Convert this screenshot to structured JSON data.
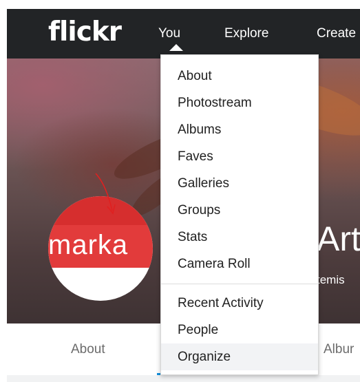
{
  "navbar": {
    "logo": "flickr",
    "links": [
      "You",
      "Explore",
      "Create"
    ]
  },
  "profile": {
    "avatar_text": "marka",
    "name": "Art",
    "handle": "temis"
  },
  "dropdown": {
    "items": [
      "About",
      "Photostream",
      "Albums",
      "Faves",
      "Galleries",
      "Groups",
      "Stats",
      "Camera Roll"
    ],
    "items_secondary": [
      "Recent Activity",
      "People",
      "Organize"
    ],
    "highlighted_item": "Organize"
  },
  "subnav": {
    "items": [
      "About",
      "Albur"
    ]
  },
  "colors": {
    "navbar_bg": "#222426",
    "accent_blue": "#128fdc",
    "avatar_red": "#e23b3b",
    "annotation_red": "#e02020"
  }
}
